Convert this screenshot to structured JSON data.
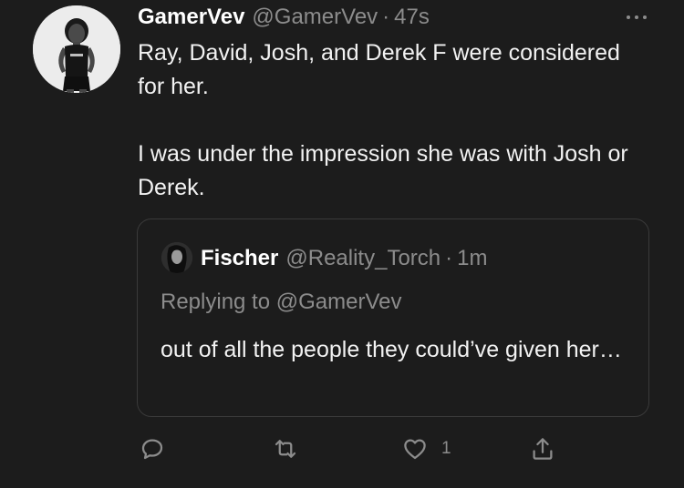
{
  "tweet": {
    "author": {
      "display_name": "GamerVev",
      "handle": "@GamerVev",
      "separator": "·",
      "timestamp": "47s"
    },
    "paragraphs": [
      "Ray, David, Josh, and Derek F were considered for her.",
      "I was under the impression she was with Josh or Derek."
    ],
    "more_icon": "more-horizontal-icon"
  },
  "quoted_tweet": {
    "author": {
      "display_name": "Fischer",
      "handle": "@Reality_Torch",
      "separator": "·",
      "timestamp": "1m"
    },
    "replying_to": "Replying to @GamerVev",
    "text": "out of all the people they could’ve given her…"
  },
  "actions": {
    "reply_icon": "reply-icon",
    "retweet_icon": "retweet-icon",
    "like_icon": "heart-icon",
    "like_count": "1",
    "share_icon": "share-icon"
  },
  "colors": {
    "background": "#1c1c1c",
    "primary_text": "#ffffff",
    "secondary_text": "#8c8c8c",
    "border": "#3a3a3a"
  }
}
